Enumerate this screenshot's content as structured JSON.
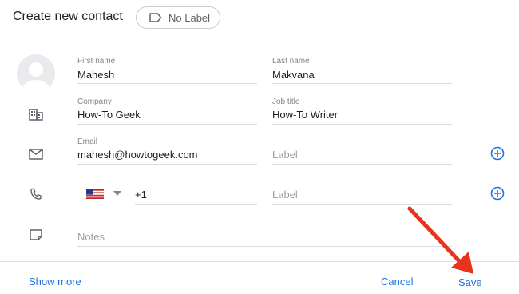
{
  "header": {
    "title": "Create new contact",
    "label_chip": "No Label"
  },
  "fields": {
    "first_name": {
      "label": "First name",
      "value": "Mahesh"
    },
    "last_name": {
      "label": "Last name",
      "value": "Makvana"
    },
    "company": {
      "label": "Company",
      "value": "How-To Geek"
    },
    "job_title": {
      "label": "Job title",
      "value": "How-To Writer"
    },
    "email": {
      "label": "Email",
      "value": "mahesh@howtogeek.com",
      "label_placeholder": "Label"
    },
    "phone": {
      "value": "+1",
      "label_placeholder": "Label"
    },
    "notes": {
      "placeholder": "Notes"
    }
  },
  "footer": {
    "show_more": "Show more",
    "cancel": "Cancel",
    "save": "Save"
  },
  "colors": {
    "accent": "#1a73e8",
    "arrow": "#e8341c"
  }
}
